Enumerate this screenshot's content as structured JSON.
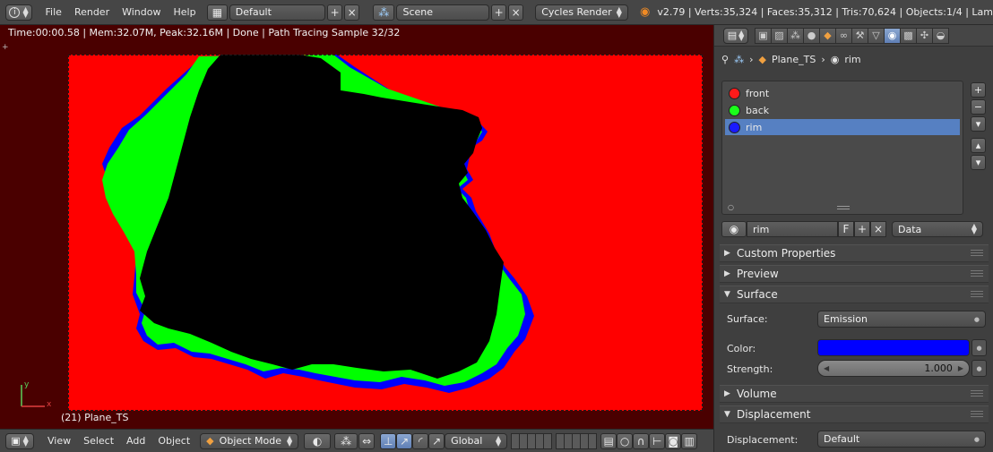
{
  "top": {
    "menus": [
      "File",
      "Render",
      "Window",
      "Help"
    ],
    "screen_layout": "Default",
    "scene": "Scene",
    "render_engine": "Cycles Render",
    "stats": "v2.79 | Verts:35,324 | Faces:35,312 | Tris:70,624 | Objects:1/4 | Lam"
  },
  "viewport": {
    "render_info": "Time:00:00.58 | Mem:32.07M, Peak:32.16M | Done | Path Tracing Sample 32/32",
    "object_label": "(21) Plane_TS",
    "axis_y": "y",
    "axis_x": "x",
    "colors": {
      "background": "#ff0000",
      "front": "#000000",
      "back": "#00ff00",
      "rim": "#0000ff"
    }
  },
  "bottom": {
    "menus": [
      "View",
      "Select",
      "Add",
      "Object"
    ],
    "mode": "Object Mode",
    "orientation": "Global"
  },
  "props": {
    "breadcrumb": {
      "object": "Plane_TS",
      "material": "rim"
    },
    "slots": [
      {
        "name": "front",
        "color": "#ff1a1a"
      },
      {
        "name": "back",
        "color": "#1aff1a"
      },
      {
        "name": "rim",
        "color": "#1a1aff"
      }
    ],
    "material_name": "rim",
    "fake_user": "F",
    "link": "Data",
    "panels": {
      "custom_properties": "Custom Properties",
      "preview": "Preview",
      "surface": "Surface",
      "volume": "Volume",
      "displacement": "Displacement"
    },
    "surface": {
      "surface_label": "Surface:",
      "surface_value": "Emission",
      "color_label": "Color:",
      "color_value": "#0000ff",
      "strength_label": "Strength:",
      "strength_value": "1.000"
    },
    "displacement": {
      "label": "Displacement:",
      "value": "Default"
    }
  }
}
